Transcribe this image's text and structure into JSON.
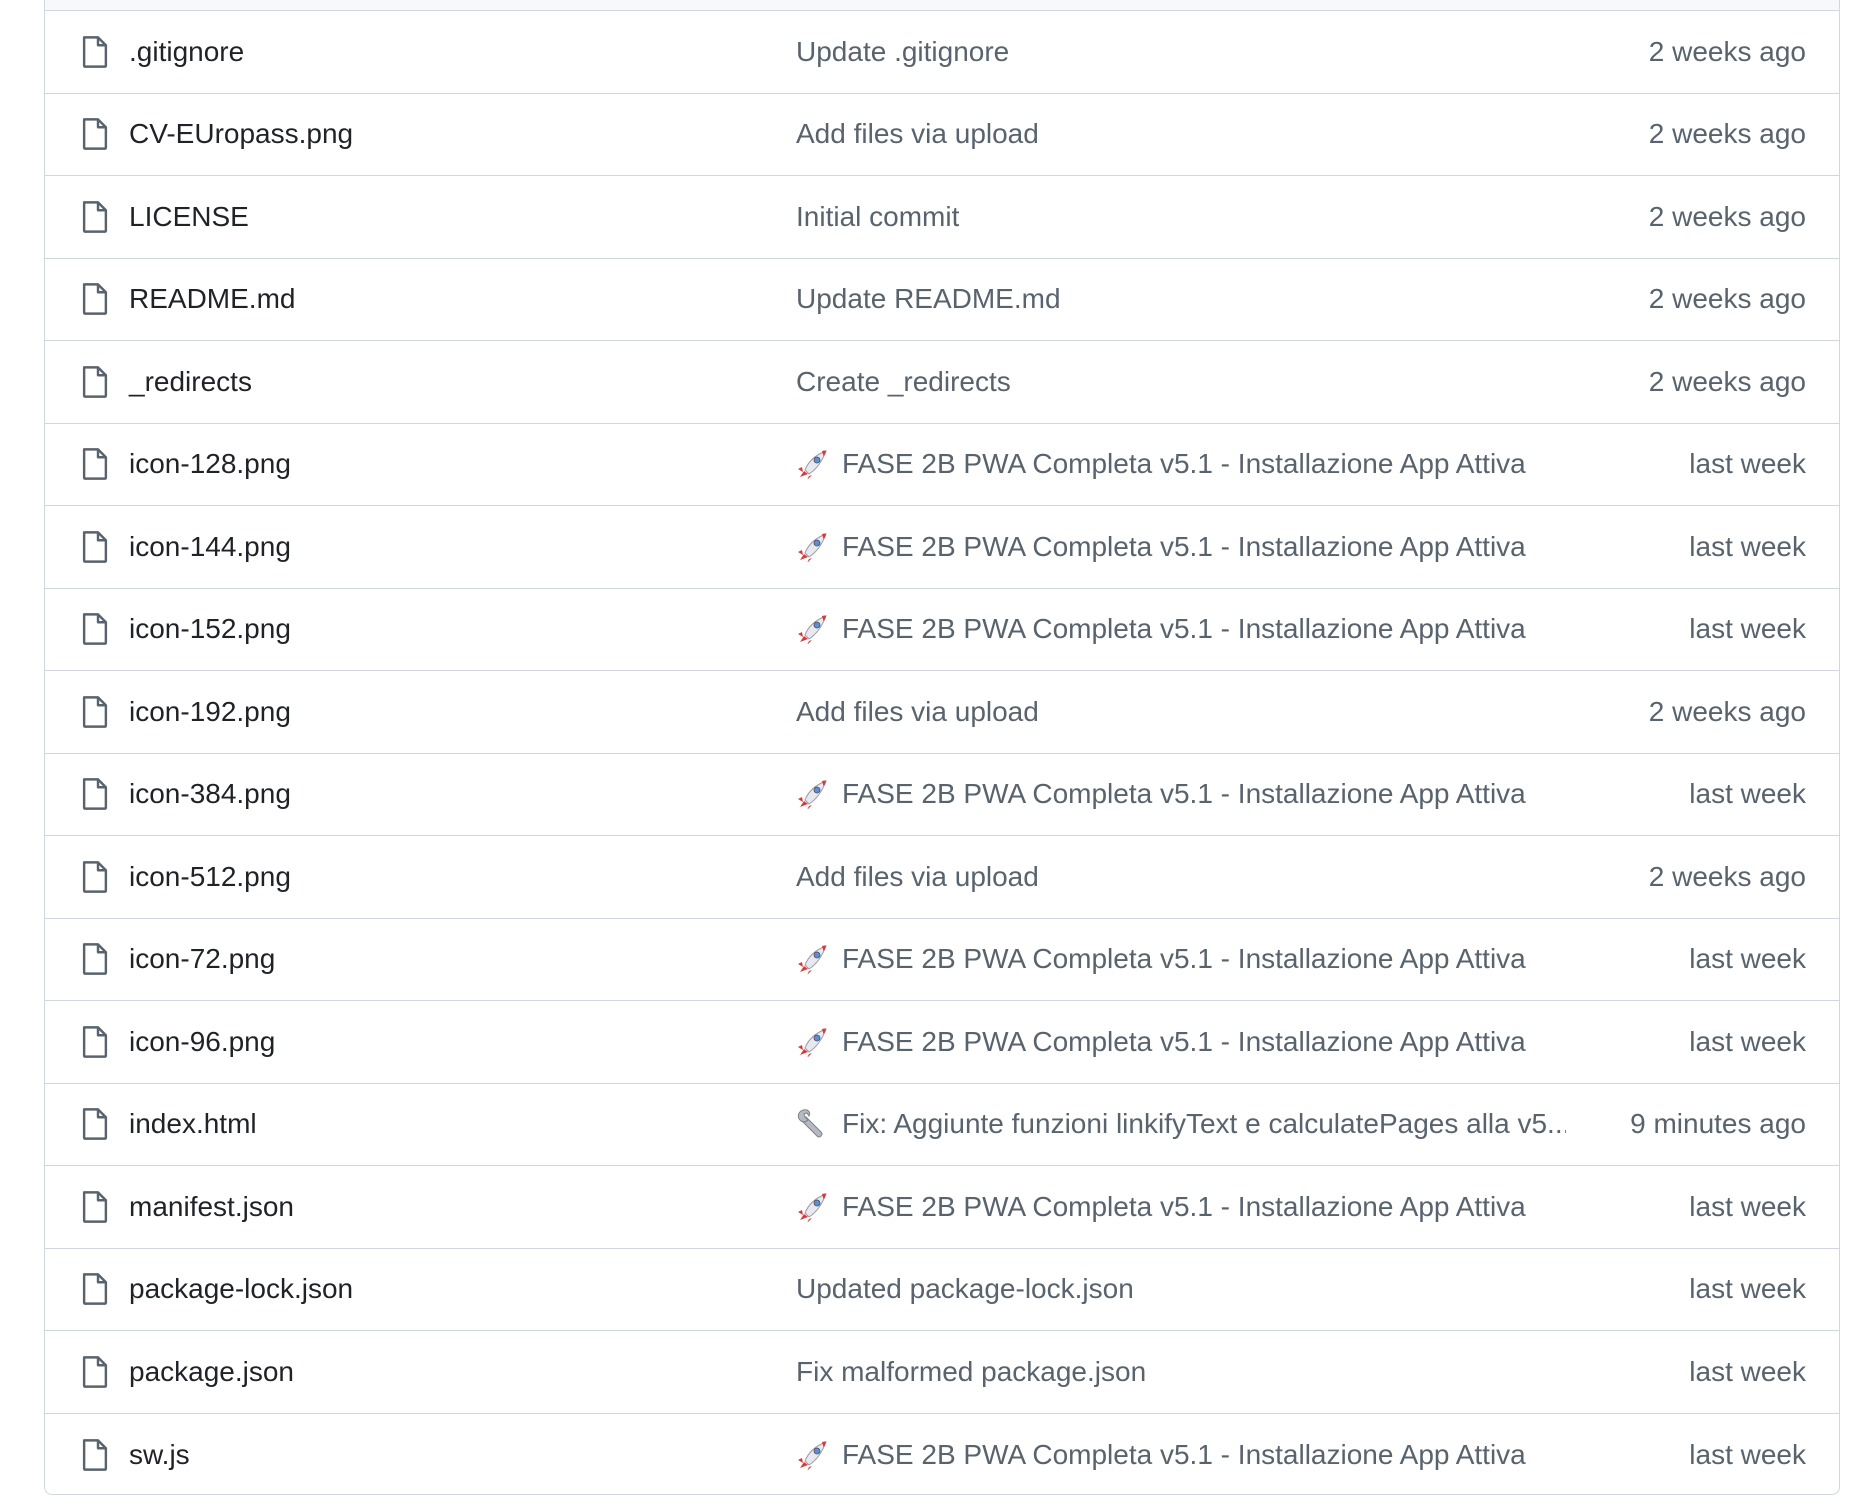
{
  "files": [
    {
      "name": ".gitignore",
      "commit_icon": "",
      "commit": "Update .gitignore",
      "time": "2 weeks ago"
    },
    {
      "name": "CV-EUropass.png",
      "commit_icon": "",
      "commit": "Add files via upload",
      "time": "2 weeks ago"
    },
    {
      "name": "LICENSE",
      "commit_icon": "",
      "commit": "Initial commit",
      "time": "2 weeks ago"
    },
    {
      "name": "README.md",
      "commit_icon": "",
      "commit": "Update README.md",
      "time": "2 weeks ago"
    },
    {
      "name": "_redirects",
      "commit_icon": "",
      "commit": "Create _redirects",
      "time": "2 weeks ago"
    },
    {
      "name": "icon-128.png",
      "commit_icon": "rocket-icon",
      "commit": "FASE 2B PWA Completa v5.1 - Installazione App Attiva",
      "time": "last week"
    },
    {
      "name": "icon-144.png",
      "commit_icon": "rocket-icon",
      "commit": "FASE 2B PWA Completa v5.1 - Installazione App Attiva",
      "time": "last week"
    },
    {
      "name": "icon-152.png",
      "commit_icon": "rocket-icon",
      "commit": "FASE 2B PWA Completa v5.1 - Installazione App Attiva",
      "time": "last week"
    },
    {
      "name": "icon-192.png",
      "commit_icon": "",
      "commit": "Add files via upload",
      "time": "2 weeks ago"
    },
    {
      "name": "icon-384.png",
      "commit_icon": "rocket-icon",
      "commit": "FASE 2B PWA Completa v5.1 - Installazione App Attiva",
      "time": "last week"
    },
    {
      "name": "icon-512.png",
      "commit_icon": "",
      "commit": "Add files via upload",
      "time": "2 weeks ago"
    },
    {
      "name": "icon-72.png",
      "commit_icon": "rocket-icon",
      "commit": "FASE 2B PWA Completa v5.1 - Installazione App Attiva",
      "time": "last week"
    },
    {
      "name": "icon-96.png",
      "commit_icon": "rocket-icon",
      "commit": "FASE 2B PWA Completa v5.1 - Installazione App Attiva",
      "time": "last week"
    },
    {
      "name": "index.html",
      "commit_icon": "wrench-icon",
      "commit": "Fix: Aggiunte funzioni linkifyText e calculatePages alla v5....",
      "time": "9 minutes ago"
    },
    {
      "name": "manifest.json",
      "commit_icon": "rocket-icon",
      "commit": "FASE 2B PWA Completa v5.1 - Installazione App Attiva",
      "time": "last week"
    },
    {
      "name": "package-lock.json",
      "commit_icon": "",
      "commit": "Updated package-lock.json",
      "time": "last week"
    },
    {
      "name": "package.json",
      "commit_icon": "",
      "commit": "Fix malformed package.json",
      "time": "last week"
    },
    {
      "name": "sw.js",
      "commit_icon": "rocket-icon",
      "commit": "FASE 2B PWA Completa v5.1 - Installazione App Attiva",
      "time": "last week"
    }
  ],
  "colors": {
    "border": "#d0d7de",
    "text_primary": "#1f2328",
    "text_muted": "#59636e",
    "rocket_body": "#e8e8ee",
    "rocket_accent": "#d63a3a"
  }
}
